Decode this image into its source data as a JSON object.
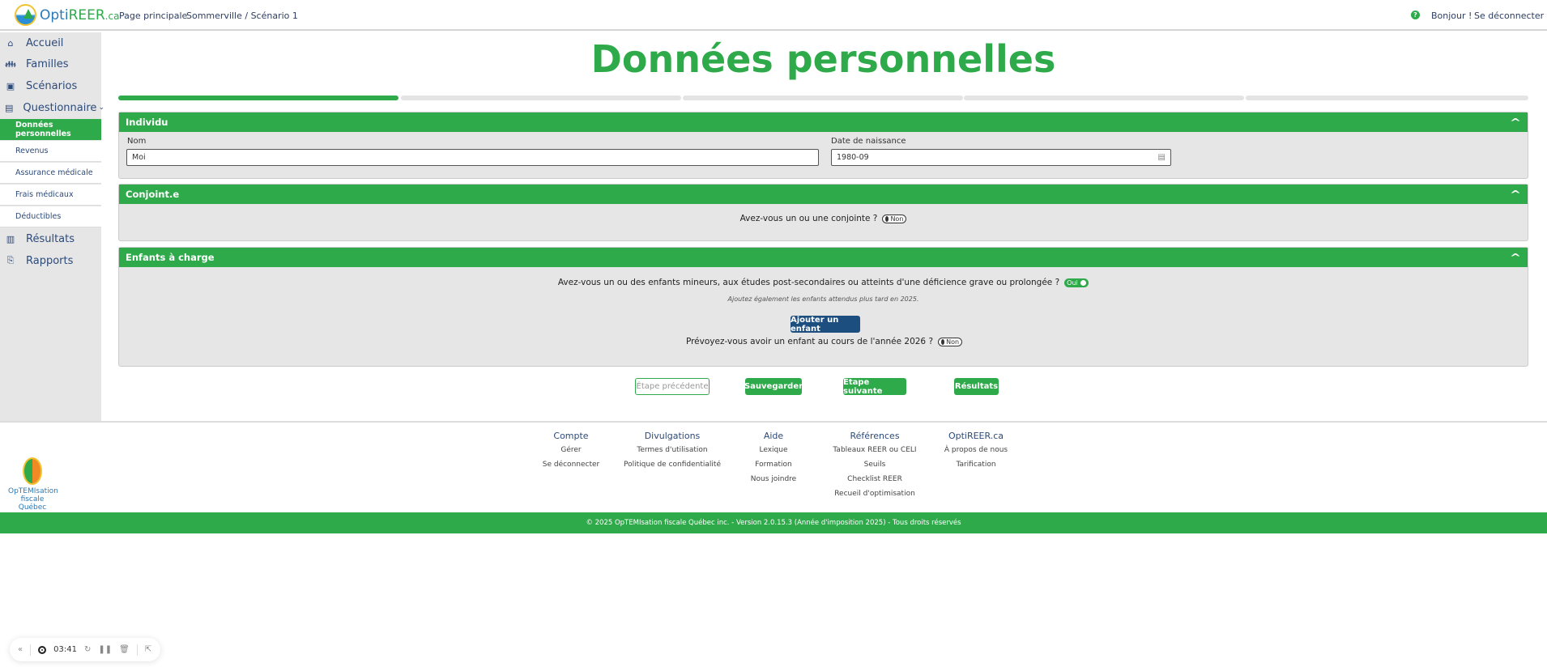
{
  "header": {
    "logo": "OptiREER.ca",
    "logo_parts": [
      "Opti",
      "REER",
      ".ca"
    ],
    "nav": [
      "Page principale",
      "Sommerville / Scénario 1"
    ],
    "help_icon": "?",
    "greeting": "Bonjour !",
    "logout": "Se déconnecter"
  },
  "sidebar": {
    "items": [
      {
        "label": "Accueil",
        "icon": "home-icon"
      },
      {
        "label": "Familles",
        "icon": "users-icon"
      },
      {
        "label": "Scénarios",
        "icon": "image-icon"
      },
      {
        "label": "Questionnaire",
        "icon": "document-icon"
      },
      {
        "label": "Résultats",
        "icon": "chart-icon"
      },
      {
        "label": "Rapports",
        "icon": "report-icon"
      }
    ],
    "sub": [
      "Données personnelles",
      "Revenus",
      "Assurance médicale",
      "Frais médicaux",
      "Déductibles"
    ]
  },
  "page": {
    "title": "Données personnelles",
    "progress_step": 1,
    "progress_total": 5
  },
  "individu": {
    "title": "Individu",
    "name_label": "Nom",
    "name_value": "Moi",
    "dob_label": "Date de naissance",
    "dob_value": "1980-09"
  },
  "conjoint": {
    "title": "Conjoint.e",
    "question": "Avez-vous un ou une conjointe ?",
    "toggle": "Non"
  },
  "enfants": {
    "title": "Enfants à charge",
    "question": "Avez-vous un ou des enfants mineurs, aux études post-secondaires ou atteints d'une déficience grave ou prolongée ?",
    "toggle": "Oui",
    "note": "Ajoutez également les enfants attendus plus tard en 2025.",
    "add_button": "Ajouter un enfant",
    "question2": "Prévoyez-vous avoir un enfant au cours de l'année 2026 ?",
    "toggle2": "Non"
  },
  "actions": {
    "prev": "Étape précédente",
    "save": "Sauvegarder",
    "next": "Étape suivante",
    "results": "Résultats"
  },
  "footer": {
    "logo": "OpTEMIsation fiscale Québec",
    "columns": [
      {
        "title": "Compte",
        "links": [
          "Gérer",
          "Se déconnecter"
        ]
      },
      {
        "title": "Divulgations",
        "links": [
          "Termes d'utilisation",
          "Politique de confidentialité"
        ]
      },
      {
        "title": "Aide",
        "links": [
          "Lexique",
          "Formation",
          "Nous joindre"
        ]
      },
      {
        "title": "Références",
        "links": [
          "Tableaux REER ou CELI",
          "Seuils",
          "Checklist REER",
          "Recueil d'optimisation"
        ]
      },
      {
        "title": "OptiREER.ca",
        "links": [
          "À propos de nous",
          "Tarification"
        ]
      }
    ],
    "copyright": "© 2025 OpTEMIsation fiscale Québec inc. - Version 2.0.15.3 (Année d'imposition 2025) - Tous droits réservés"
  },
  "recorder": {
    "time": "03:41"
  },
  "colors": {
    "green": "#2eaa4a",
    "navy": "#1d4e80"
  }
}
